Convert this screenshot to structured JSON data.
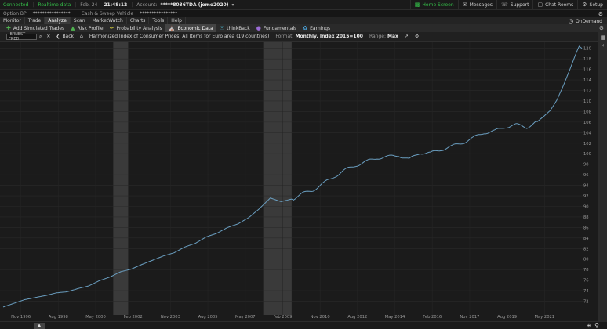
{
  "top_bar": {
    "status_connected": "Connected",
    "status_realtime": "Realtime data",
    "date": "Feb, 24",
    "time": "21:48:12",
    "account_label": "Account:",
    "account_value": "*****8036TDA (jomo2020)",
    "home_screen": "Home Screen",
    "messages": "Messages",
    "support": "Support",
    "chat_rooms": "Chat Rooms",
    "setup": "Setup"
  },
  "bp_bar": {
    "option_bp_label": "Option BP",
    "option_bp_value": "****************",
    "cash_sweep_label": "Cash & Sweep Vehicle",
    "cash_sweep_value": "****************"
  },
  "main_tabs": {
    "items": [
      "Monitor",
      "Trade",
      "Analyze",
      "Scan",
      "MarketWatch",
      "Charts",
      "Tools",
      "Help"
    ],
    "active": "Analyze",
    "ondemand": "OnDemand"
  },
  "sub_tabs": {
    "items": [
      {
        "label": "Add Simulated Trades",
        "icon": "plus-icon"
      },
      {
        "label": "Risk Profile",
        "icon": "risk-icon"
      },
      {
        "label": "Probability Analysis",
        "icon": "probability-icon"
      },
      {
        "label": "Economic Data",
        "icon": "bank-icon"
      },
      {
        "label": "thinkBack",
        "icon": "thinkback-icon"
      },
      {
        "label": "Fundamentals",
        "icon": "fundamentals-icon"
      },
      {
        "label": "Earnings",
        "icon": "bulb-icon"
      }
    ],
    "active": "Economic Data"
  },
  "chart_toolbar": {
    "symbol_placeholder": "IB/INEST FRED",
    "back": "Back",
    "series_title": "Harmonized Index of Consumer Prices: All Items for Euro area (19 countries)",
    "format_label": "Format:",
    "format_value": "Monthly, Index 2015=100",
    "range_label": "Range:",
    "range_value": "Max"
  },
  "chart_data": {
    "type": "line",
    "title": "Harmonized Index of Consumer Prices: All Items for Euro area (19 countries)",
    "line_color": "#6a9ec0",
    "recession_color": "#3a3a3a",
    "background": "#1b1b1b",
    "grid": true,
    "ylim": [
      70,
      121
    ],
    "y_ticks": [
      72,
      74,
      76,
      78,
      80,
      82,
      84,
      86,
      88,
      90,
      92,
      94,
      96,
      98,
      100,
      102,
      104,
      106,
      108,
      110,
      112,
      114,
      116,
      118,
      120
    ],
    "xlim": [
      1996.0,
      2023.08
    ],
    "x_ticks": [
      {
        "label": "Nov 1996",
        "x": 1996.83
      },
      {
        "label": "Aug 1998",
        "x": 1998.58
      },
      {
        "label": "May 2000",
        "x": 2000.33
      },
      {
        "label": "Feb 2002",
        "x": 2002.08
      },
      {
        "label": "Nov 2003",
        "x": 2003.83
      },
      {
        "label": "Aug 2005",
        "x": 2005.58
      },
      {
        "label": "May 2007",
        "x": 2007.33
      },
      {
        "label": "Feb 2009",
        "x": 2009.08
      },
      {
        "label": "Nov 2010",
        "x": 2010.83
      },
      {
        "label": "Aug 2012",
        "x": 2012.58
      },
      {
        "label": "May 2014",
        "x": 2014.33
      },
      {
        "label": "Feb 2016",
        "x": 2016.08
      },
      {
        "label": "Nov 2017",
        "x": 2017.83
      },
      {
        "label": "Aug 2019",
        "x": 2019.58
      },
      {
        "label": "May 2021",
        "x": 2021.33
      }
    ],
    "recessions": [
      [
        2001.15,
        2001.85
      ],
      [
        2008.17,
        2009.5
      ]
    ],
    "series": [
      {
        "x": [
          1996.0,
          1996.5,
          1997.0,
          1997.5,
          1998.0,
          1998.5,
          1999.0,
          1999.5,
          2000.0,
          2000.5,
          2001.0,
          2001.5,
          2002.0,
          2002.5,
          2003.0,
          2003.5,
          2004.0,
          2004.5,
          2005.0,
          2005.5,
          2006.0,
          2006.5,
          2007.0,
          2007.5,
          2008.0,
          2008.5,
          2009.0,
          2009.5,
          2010.0,
          2010.5,
          2011.0,
          2011.5,
          2012.0,
          2012.5,
          2013.0,
          2013.5,
          2014.0,
          2014.5,
          2015.0,
          2015.5,
          2016.0,
          2016.5,
          2017.0,
          2017.5,
          2018.0,
          2018.5,
          2019.0,
          2019.5,
          2020.0,
          2020.5,
          2021.0,
          2021.3,
          2021.6,
          2021.9,
          2022.2,
          2022.5,
          2022.8,
          2022.95,
          2023.08
        ],
        "y": [
          70.9,
          71.6,
          72.3,
          72.7,
          73.1,
          73.6,
          73.8,
          74.4,
          74.9,
          75.9,
          76.6,
          77.6,
          78.1,
          79.0,
          79.8,
          80.6,
          81.2,
          82.3,
          83.0,
          84.2,
          84.9,
          86.0,
          86.7,
          87.9,
          89.6,
          91.6,
          90.9,
          91.4,
          92.3,
          93.2,
          94.3,
          95.8,
          96.8,
          97.9,
          98.4,
          99.3,
          99.3,
          99.8,
          98.8,
          100.3,
          100.0,
          100.9,
          101.3,
          102.2,
          102.9,
          104.1,
          104.2,
          105.2,
          105.4,
          105.1,
          106.1,
          107.1,
          108.2,
          110.1,
          112.8,
          115.8,
          119.0,
          120.4,
          120.0
        ]
      }
    ]
  },
  "icons": {
    "gear": "gear-icon",
    "zoom_in": "zoom-in-icon",
    "zoom_out": "zoom-out-icon",
    "collapse": "collapse-icon"
  }
}
